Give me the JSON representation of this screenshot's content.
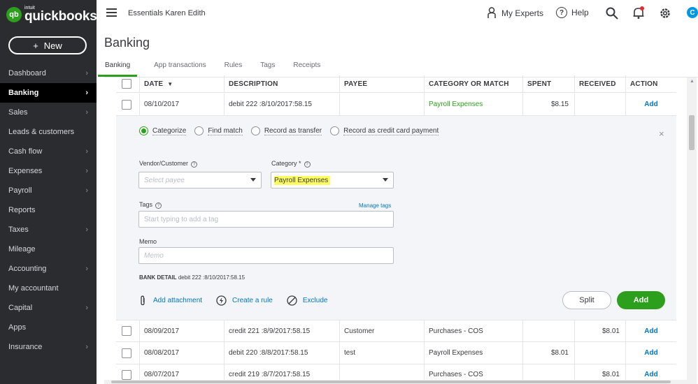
{
  "brand": {
    "small": "intuit",
    "name": "quickbooks",
    "mark": "qb"
  },
  "new_button": {
    "plus": "+",
    "label": "New"
  },
  "sidebar": {
    "items": [
      {
        "label": "Dashboard",
        "active": false
      },
      {
        "label": "Banking",
        "active": true
      },
      {
        "label": "Sales",
        "active": false
      },
      {
        "label": "Leads & customers",
        "active": false
      },
      {
        "label": "Cash flow",
        "active": false
      },
      {
        "label": "Expenses",
        "active": false
      },
      {
        "label": "Payroll",
        "active": false
      },
      {
        "label": "Reports",
        "active": false
      },
      {
        "label": "Taxes",
        "active": false
      },
      {
        "label": "Mileage",
        "active": false
      },
      {
        "label": "Accounting",
        "active": false
      },
      {
        "label": "My accountant",
        "active": false
      },
      {
        "label": "Capital",
        "active": false
      },
      {
        "label": "Apps",
        "active": false
      },
      {
        "label": "Insurance",
        "active": false
      }
    ]
  },
  "topbar": {
    "company": "Essentials Karen Edith",
    "my_experts": "My Experts",
    "help": "Help",
    "avatar": "C"
  },
  "page": {
    "title": "Banking"
  },
  "tabs": [
    "Banking",
    "App transactions",
    "Rules",
    "Tags",
    "Receipts"
  ],
  "table": {
    "headers": [
      "DATE",
      "DESCRIPTION",
      "PAYEE",
      "CATEGORY OR MATCH",
      "SPENT",
      "RECEIVED",
      "ACTION"
    ],
    "sort_indicator": "▼",
    "rows": [
      {
        "date": "08/10/2017",
        "description": "debit 222 :8/10/2017:58.15",
        "payee": "",
        "category": "Payroll Expenses",
        "spent": "$8.15",
        "received": "",
        "action": "Add"
      },
      {
        "date": "08/09/2017",
        "description": "credit 221 :8/9/2017:58.15",
        "payee": "Customer",
        "category": "Purchases - COS",
        "spent": "",
        "received": "$8.01",
        "action": "Add"
      },
      {
        "date": "08/08/2017",
        "description": "debit 220 :8/8/2017:58.15",
        "payee": "test",
        "category": "Payroll Expenses",
        "spent": "$8.01",
        "received": "",
        "action": "Add"
      },
      {
        "date": "08/07/2017",
        "description": "credit 219 :8/7/2017:58.15",
        "payee": "",
        "category": "Purchases - COS",
        "spent": "",
        "received": "$8.01",
        "action": "Add"
      }
    ]
  },
  "detail": {
    "radios": [
      "Categorize",
      "Find match",
      "Record as transfer",
      "Record as credit card payment"
    ],
    "selected_radio": "Categorize",
    "close": "×",
    "vendor_label": "Vendor/Customer",
    "vendor_placeholder": "Select payee",
    "category_label": "Category *",
    "category_value": "Payroll Expenses",
    "tags_label": "Tags",
    "manage_tags": "Manage tags",
    "tags_placeholder": "Start typing to add a tag",
    "memo_label": "Memo",
    "memo_placeholder": "Memo",
    "bank_detail_label": "BANK DETAIL",
    "bank_detail_value": "debit 222 :8/10/2017:58.15",
    "add_attachment": "Add attachment",
    "create_rule": "Create a rule",
    "exclude": "Exclude",
    "split": "Split",
    "add": "Add"
  },
  "colors": {
    "accent_green": "#2ca01c",
    "link_blue": "#0077c5",
    "sidebar_bg": "#2b2c2f",
    "highlight": "#fdfc63"
  }
}
